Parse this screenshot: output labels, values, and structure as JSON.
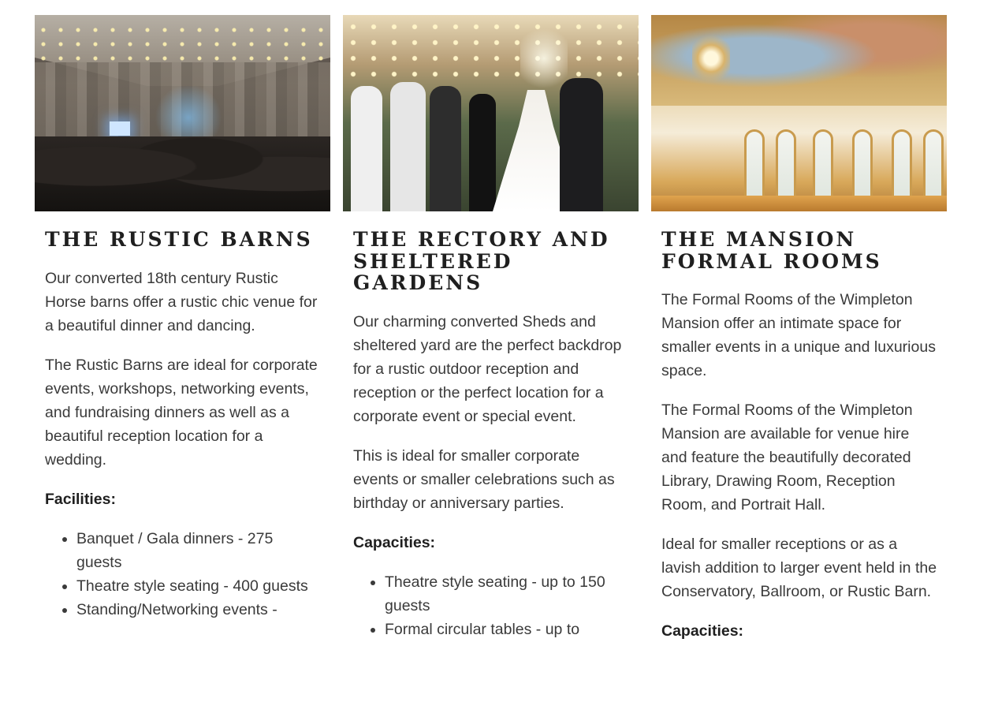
{
  "venues": [
    {
      "title": "THE RUSTIC BARNS",
      "image_alt": "Dinner event in a rustic barn with string lights",
      "paragraphs": [
        "Our converted 18th century Rustic Horse barns offer a rustic chic venue for a beautiful dinner and dancing.",
        "The Rustic Barns are ideal for corporate events, workshops, networking events, and fundraising dinners as well as a beautiful reception location for a wedding."
      ],
      "list_heading": "Facilities:",
      "items": [
        "Banquet / Gala dinners - 275 guests",
        "Theatre style seating - 400 guests",
        "Standing/Networking events -"
      ]
    },
    {
      "title": "THE RECTORY AND SHELTERED GARDENS",
      "image_alt": "Wedding guests celebrating in a garden with string lights",
      "paragraphs": [
        "Our charming converted Sheds and sheltered yard are the perfect backdrop for a rustic outdoor reception and reception or the perfect location for a corporate event or special event.",
        "This is ideal for smaller corporate events or smaller celebrations such as birthday or anniversary parties."
      ],
      "list_heading": "Capacities:",
      "items": [
        "Theatre style seating - up to 150 guests",
        "Formal circular tables - up to"
      ]
    },
    {
      "title": "THE MANSION FORMAL ROOMS",
      "image_alt": "Ornate formal room with painted ceiling and chandeliers",
      "paragraphs": [
        "The Formal Rooms of the Wimpleton Mansion offer an intimate space for smaller events in a unique and luxurious space.",
        "The Formal Rooms of the Wimpleton Mansion are available for venue hire and feature the beautifully decorated Library, Drawing Room, Reception Room, and Portrait Hall.",
        "Ideal for smaller receptions or as a lavish addition to larger event held in the Conservatory, Ballroom, or Rustic Barn."
      ],
      "list_heading": "Capacities:",
      "items": []
    }
  ]
}
